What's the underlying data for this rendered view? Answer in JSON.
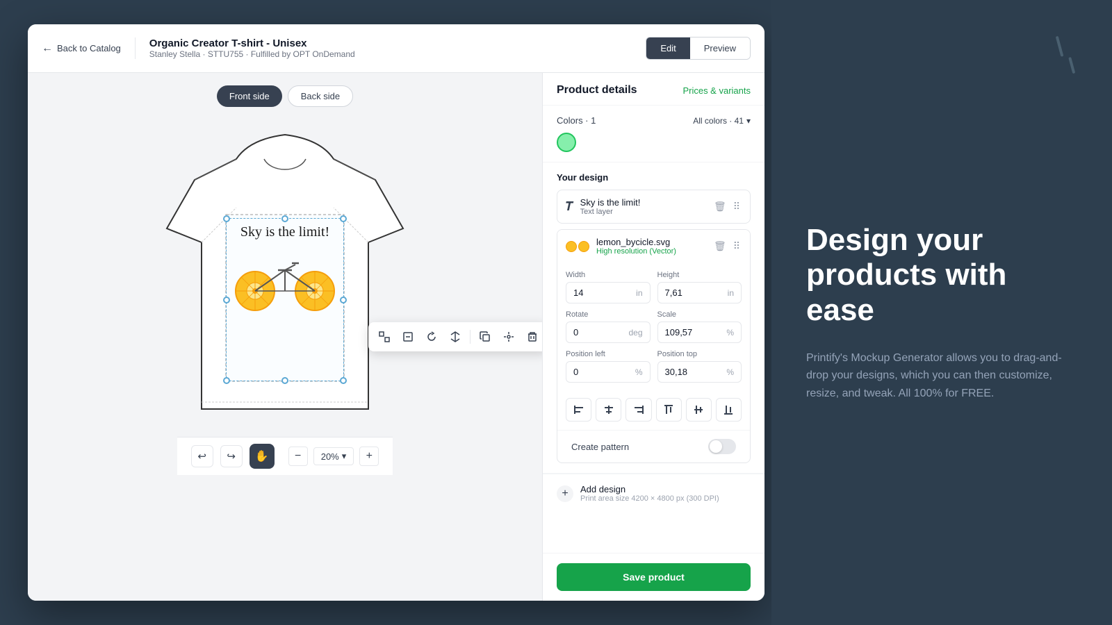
{
  "header": {
    "back_label": "Back to Catalog",
    "product_name": "Organic Creator T-shirt - Unisex",
    "product_sub": "Stanley Stella · STTU755 · Fulfilled by OPT OnDemand",
    "tab_edit": "Edit",
    "tab_preview": "Preview"
  },
  "side_tabs": {
    "front": "Front side",
    "back": "Back side"
  },
  "right_panel": {
    "title": "Product details",
    "prices_link": "Prices & variants",
    "colors": {
      "label": "Colors · 1",
      "all_label": "All colors · 41",
      "swatch_color": "#86efac"
    },
    "your_design_label": "Your design",
    "text_layer": {
      "name": "Sky is the limit!",
      "sub": "Text layer"
    },
    "svg_layer": {
      "filename": "lemon_bycicle.svg",
      "quality": "High resolution (Vector)"
    },
    "width_label": "Width",
    "width_value": "14",
    "width_unit": "in",
    "height_label": "Height",
    "height_value": "7,61",
    "height_unit": "in",
    "rotate_label": "Rotate",
    "rotate_value": "0",
    "rotate_unit": "deg",
    "scale_label": "Scale",
    "scale_value": "109,57",
    "scale_unit": "%",
    "position_left_label": "Position left",
    "position_left_value": "0",
    "position_left_unit": "%",
    "position_top_label": "Position top",
    "position_top_value": "30,18",
    "position_top_unit": "%",
    "create_pattern_label": "Create pattern",
    "add_design_label": "Add design",
    "add_design_sub": "Print area size 4200 × 4800 px (300 DPI)",
    "save_label": "Save product"
  },
  "toolbar": {
    "buttons": [
      "⊞",
      "⊟",
      "↔",
      "⤢",
      "⧉",
      "⊕",
      "🗑"
    ]
  },
  "zoom": {
    "level": "20%"
  },
  "promo": {
    "headline": "Design your products with ease",
    "body": "Printify's Mockup Generator allows you to drag-and-drop your designs, which you can then customize, resize, and tweak. All 100% for FREE."
  },
  "bottom_bar": {
    "undo": "↩",
    "redo": "↪"
  }
}
